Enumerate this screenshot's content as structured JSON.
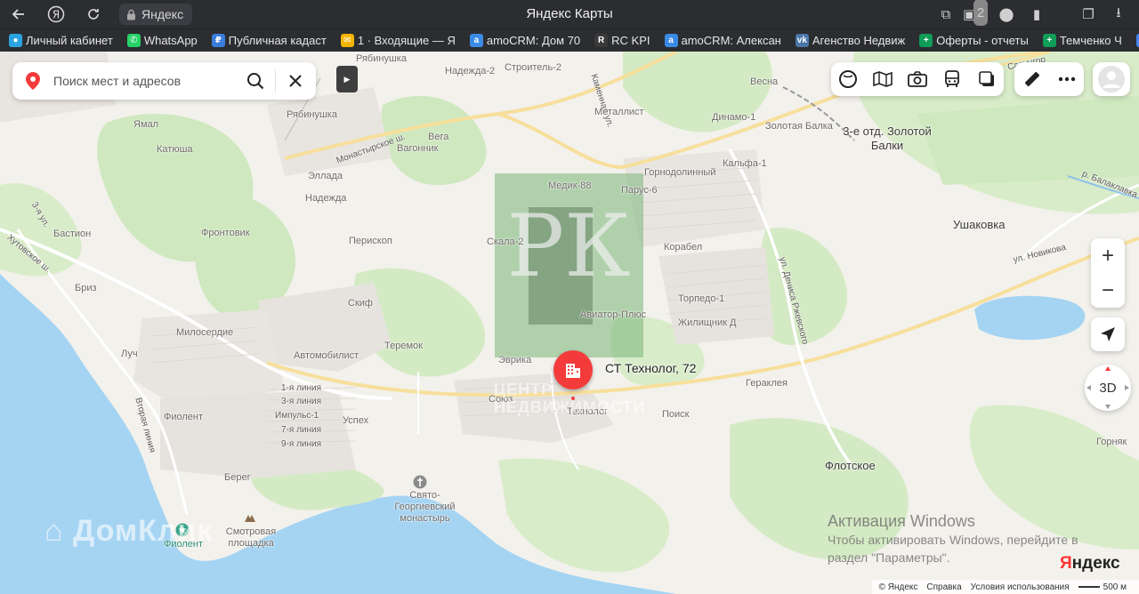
{
  "browser": {
    "address_label": "Яндекс",
    "window_title": "Яндекс Карты",
    "tab_badge": "2",
    "bookmarks": [
      {
        "label": "Личный кабинет",
        "color": "#2aa4e0",
        "glyph": "●"
      },
      {
        "label": "WhatsApp",
        "color": "#25d366",
        "glyph": "✆"
      },
      {
        "label": "Публичная кадаст",
        "color": "#3b7ddd",
        "glyph": "₽"
      },
      {
        "label": "1 · Входящие — Я",
        "color": "#f5b400",
        "glyph": "✉"
      },
      {
        "label": "amoCRM: Дом 70",
        "color": "#3a8be6",
        "glyph": "a"
      },
      {
        "label": "RC KPI",
        "color": "#3a3a3a",
        "glyph": "R"
      },
      {
        "label": "amoCRM: Алексан",
        "color": "#3a8be6",
        "glyph": "a"
      },
      {
        "label": "Агенство Недвиж",
        "color": "#4a76a8",
        "glyph": "vk"
      },
      {
        "label": "Оферты - отчеты",
        "color": "#0f9d58",
        "glyph": "+"
      },
      {
        "label": "Темченко Ч",
        "color": "#0f9d58",
        "glyph": "+"
      }
    ]
  },
  "search": {
    "placeholder": "Поиск мест и адресов"
  },
  "poi": {
    "label": "СТ Технолог, 72",
    "color": "#f43b3b"
  },
  "map_labels": {
    "ryabinushka_top": "Рябинушка",
    "nadezhda2": "Надежда-2",
    "stroitel2": "Строитель-2",
    "kamennaya": "Каменная ул.",
    "vesna": "Весна",
    "sapun": "Сапунгор",
    "ryabinushka": "Рябинушка",
    "metallist": "Металлист",
    "dinamo1": "Динамо-1",
    "zolotaya_balka": "Золотая Балка",
    "zolotoy_balki": "3-е отд. Золотой Балки",
    "monastyrskoe": "Монастырское ш.",
    "yamal": "Ямал",
    "vega": "Вега",
    "katyusha": "Катюша",
    "vagonnik": "Вагонник",
    "gornodolinny": "Горнодолинный",
    "kalfa1": "Кальфа-1",
    "medik88": "Медик-88",
    "ellada": "Эллада",
    "parus6": "Парус-6",
    "balaklavka": "р. Балаклавка",
    "nadezhda": "Надежда",
    "ul3ya": "3-я ул.",
    "bastion": "Бастион",
    "frontovik": "Фронтовик",
    "skala2": "Скала-2",
    "periskop": "Перископ",
    "korabel": "Корабел",
    "ushakovka": "Ушаковка",
    "novikova": "ул. Новикова",
    "denisa": "ул. Дениса Ржевского",
    "vetrovskoe": "Хутовское ш.",
    "briz": "Бриз",
    "skif": "Скиф",
    "torpedo1": "Торпедо-1",
    "aviator": "Авиатор-Плюс",
    "zhilishchnik": "Жилищник Д",
    "miloserdie": "Милосердие",
    "teremok": "Теремок",
    "luch": "Луч",
    "avtomobilist": "Автомобилист",
    "evrika": "Эврика",
    "geraklea": "Гераклея",
    "liniya1": "1-я линия",
    "liniya3": "3-я линия",
    "impuls1": "Импульс-1",
    "liniya7": "7-я линия",
    "liniya9": "9-я линия",
    "vtoraya": "Вторая линия",
    "fiolent_village": "Фиолент",
    "soyuz": "Союз",
    "uspekh": "Успех",
    "tekhnolog": "Технолог",
    "poisk": "Поиск",
    "gorniak": "Горняк",
    "flotskoe": "Флотское",
    "bereg": "Берег",
    "monastyr": "Свято-Георгиевский монастырь",
    "fiolent": "Фиолент",
    "smotrovaya": "Смотровая площадка"
  },
  "watermark": {
    "letters": "РК",
    "text_line1": "ЦЕНТР",
    "text_line2": "НЕДВИЖИМОСТИ",
    "domclick": "ДомКлик"
  },
  "controls": {
    "zoom_in": "+",
    "zoom_out": "−",
    "mode_3d": "3D"
  },
  "windows_activation": {
    "title": "Активация Windows",
    "line1": "Чтобы активировать Windows, перейдите в",
    "line2": "раздел \"Параметры\"."
  },
  "footer": {
    "copyright": "© Яндекс",
    "help": "Справка",
    "terms": "Условия использования",
    "scale": "500 м"
  },
  "logo": {
    "ya": "Я",
    "ndeks": "ндекс"
  }
}
